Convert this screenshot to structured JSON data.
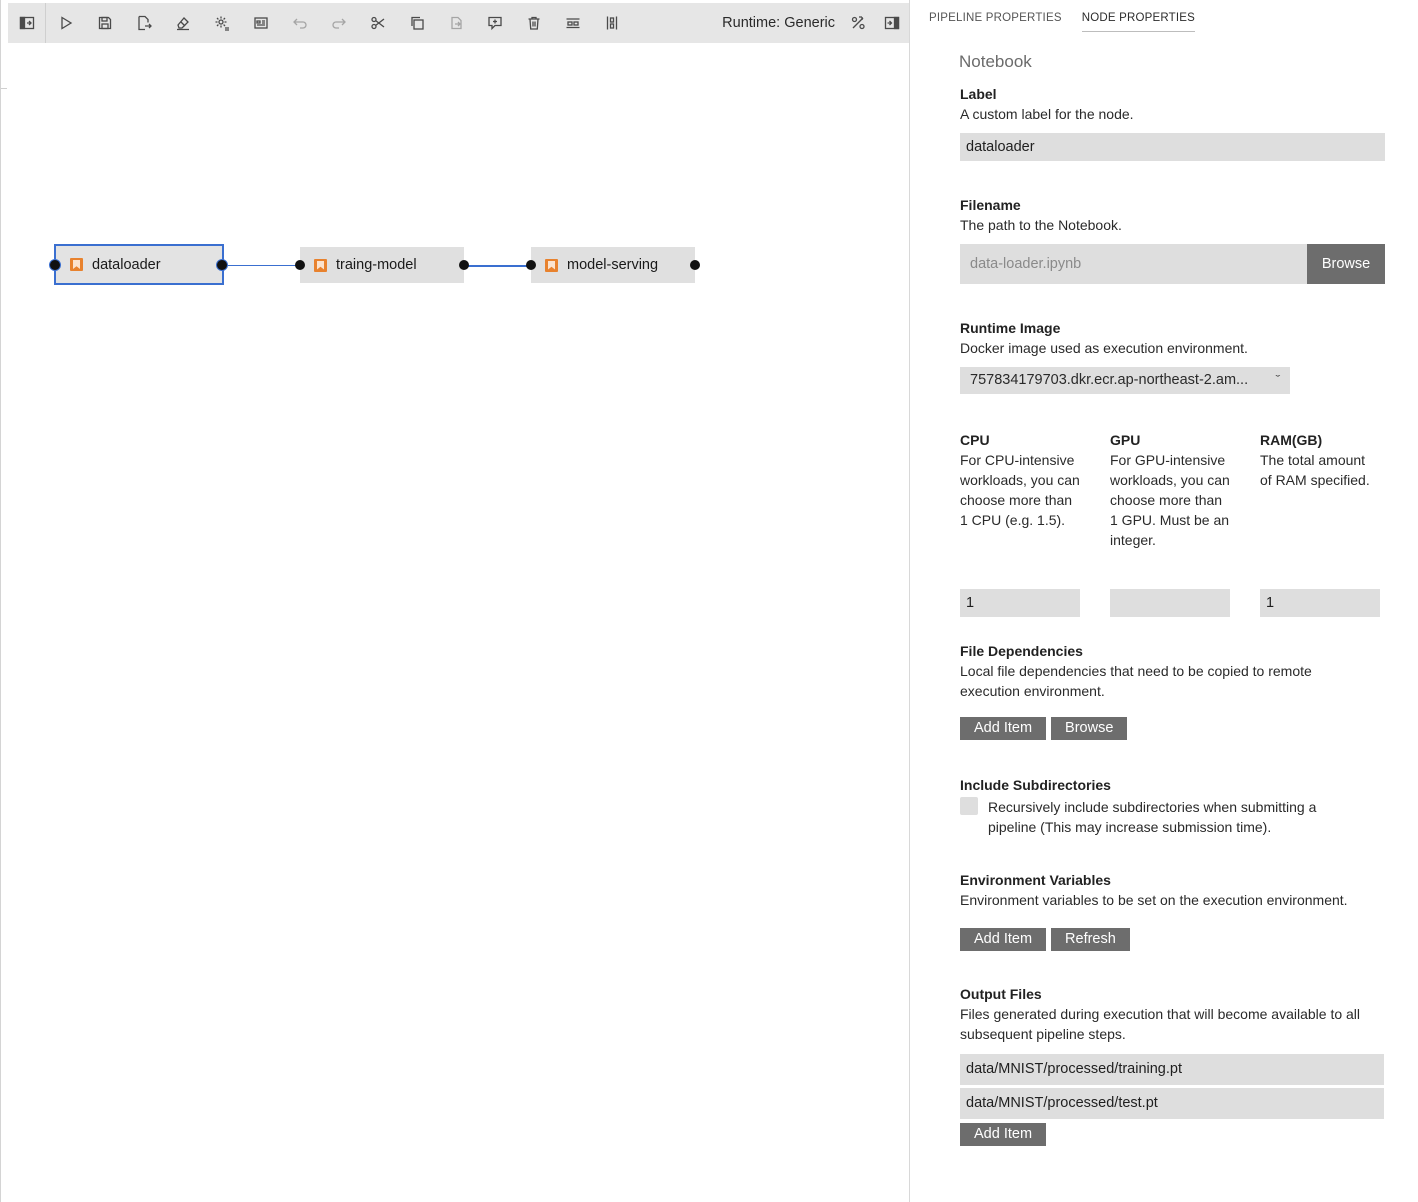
{
  "toolbar": {
    "runtime_label": "Runtime: Generic",
    "buttons": [
      "toggle-left-panel-icon",
      "run-icon",
      "save-icon",
      "export-icon",
      "clear-icon",
      "open-runtimes-icon",
      "open-runtime-images-icon",
      "undo-icon",
      "redo-icon",
      "cut-icon",
      "copy-icon",
      "paste-icon",
      "add-comment-icon",
      "delete-icon",
      "arrange-horizontal-icon",
      "arrange-vertical-icon"
    ]
  },
  "nodes": [
    {
      "label": "dataloader",
      "selected": true
    },
    {
      "label": "traing-model",
      "selected": false
    },
    {
      "label": "model-serving",
      "selected": false
    }
  ],
  "panel": {
    "tabs": [
      "PIPELINE PROPERTIES",
      "NODE PROPERTIES"
    ],
    "active_tab": "NODE PROPERTIES",
    "node_type": "Notebook",
    "label": {
      "title": "Label",
      "desc": "A custom label for the node.",
      "value": "dataloader"
    },
    "filename": {
      "title": "Filename",
      "desc": "The path to the Notebook.",
      "placeholder": "data-loader.ipynb",
      "browse": "Browse"
    },
    "runtime_image": {
      "title": "Runtime Image",
      "desc": "Docker image used as execution environment.",
      "value": "757834179703.dkr.ecr.ap-northeast-2.am..."
    },
    "cpu": {
      "title": "CPU",
      "desc": "For CPU-intensive workloads, you can choose more than 1 CPU (e.g. 1.5).",
      "value": "1"
    },
    "gpu": {
      "title": "GPU",
      "desc": "For GPU-intensive workloads, you can choose more than 1 GPU. Must be an integer.",
      "value": ""
    },
    "ram": {
      "title": "RAM(GB)",
      "desc": "The total amount of RAM specified.",
      "value": "1"
    },
    "file_deps": {
      "title": "File Dependencies",
      "desc": "Local file dependencies that need to be copied to remote execution environment.",
      "add": "Add Item",
      "browse": "Browse"
    },
    "subdirs": {
      "title": "Include Subdirectories",
      "desc": "Recursively include subdirectories when submitting a pipeline (This may increase submission time).",
      "checked": false
    },
    "env_vars": {
      "title": "Environment Variables",
      "desc": "Environment variables to be set on the execution environment.",
      "add": "Add Item",
      "refresh": "Refresh"
    },
    "outputs": {
      "title": "Output Files",
      "desc": "Files generated during execution that will become available to all subsequent pipeline steps.",
      "items": [
        "data/MNIST/processed/training.pt",
        "data/MNIST/processed/test.pt"
      ],
      "add": "Add Item"
    }
  },
  "colors": {
    "selection": "#3a6fd0",
    "notebook_icon": "#e8822e",
    "button": "#6d6d6d"
  }
}
